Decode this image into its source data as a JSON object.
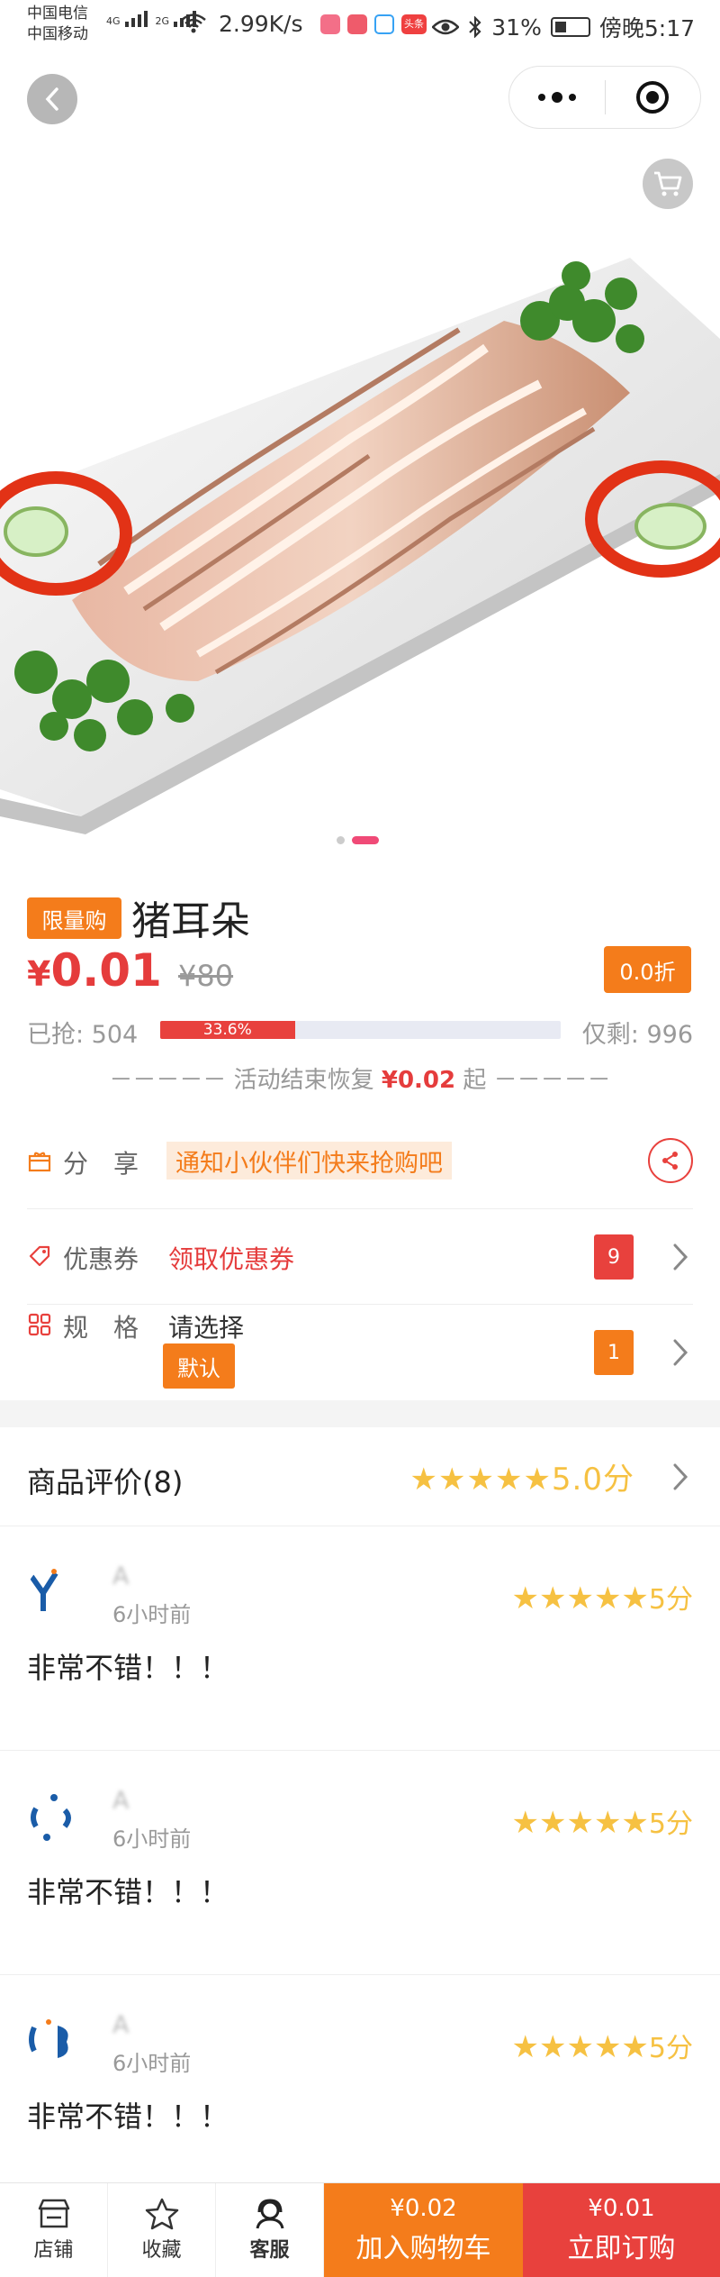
{
  "status_bar": {
    "carrier1": "中国电信",
    "carrier2": "中国移动",
    "net1": "4G",
    "net2": "2G",
    "speed": "2.99K/s",
    "app_badge": "头条",
    "battery": "31%",
    "time": "傍晚5:17"
  },
  "nav": {
    "back_icon": "chevron-left-icon",
    "menu_icon": "more-dots-icon",
    "close_icon": "target-icon",
    "cart_icon": "cart-icon"
  },
  "hero": {
    "image": "plate of sliced pig ear with cilantro and red pepper rings",
    "page_count": 2,
    "current_page": 2
  },
  "product": {
    "tag": "限量购",
    "title": "猪耳朵",
    "price_symbol": "¥",
    "price": "0.01",
    "original_price": "¥80",
    "discount": "0.0折",
    "sold_text": "已抢: 504",
    "progress_text": "33.6%",
    "progress_fraction": 0.336,
    "remain_text": "仅剩: 996",
    "restore_prefix": "－－－－－ 活动结束恢复 ",
    "restore_price": "¥0.02",
    "restore_suffix": " 起 －－－－－"
  },
  "share": {
    "label": "分　享",
    "note": "通知小伙伴们快来抢购吧",
    "icon": "share-icon"
  },
  "coupon": {
    "label": "优惠券",
    "link": "领取优惠券",
    "count": "9"
  },
  "spec": {
    "label": "规　格",
    "value": "请选择",
    "default_tag": "默认",
    "count": "1"
  },
  "reviews_header": {
    "title": "商品评价(8)",
    "stars": "★★★★★",
    "score": "5.0分"
  },
  "reviews": [
    {
      "name": "A",
      "time": "6小时前",
      "stars": "★★★★★",
      "score": "5分",
      "text": "非常不错！！！"
    },
    {
      "name": "A",
      "time": "6小时前",
      "stars": "★★★★★",
      "score": "5分",
      "text": "非常不错！！！"
    },
    {
      "name": "A",
      "time": "6小时前",
      "stars": "★★★★★",
      "score": "5分",
      "text": "非常不错！！！"
    }
  ],
  "bottom": {
    "store": "店铺",
    "favorite": "收藏",
    "service": "客服",
    "cart_price": "¥0.02",
    "cart_label": "加入购物车",
    "order_price": "¥0.01",
    "order_label": "立即订购"
  },
  "colors": {
    "accent_orange": "#f47c1b",
    "accent_red": "#e8413d",
    "star": "#f6c142"
  }
}
